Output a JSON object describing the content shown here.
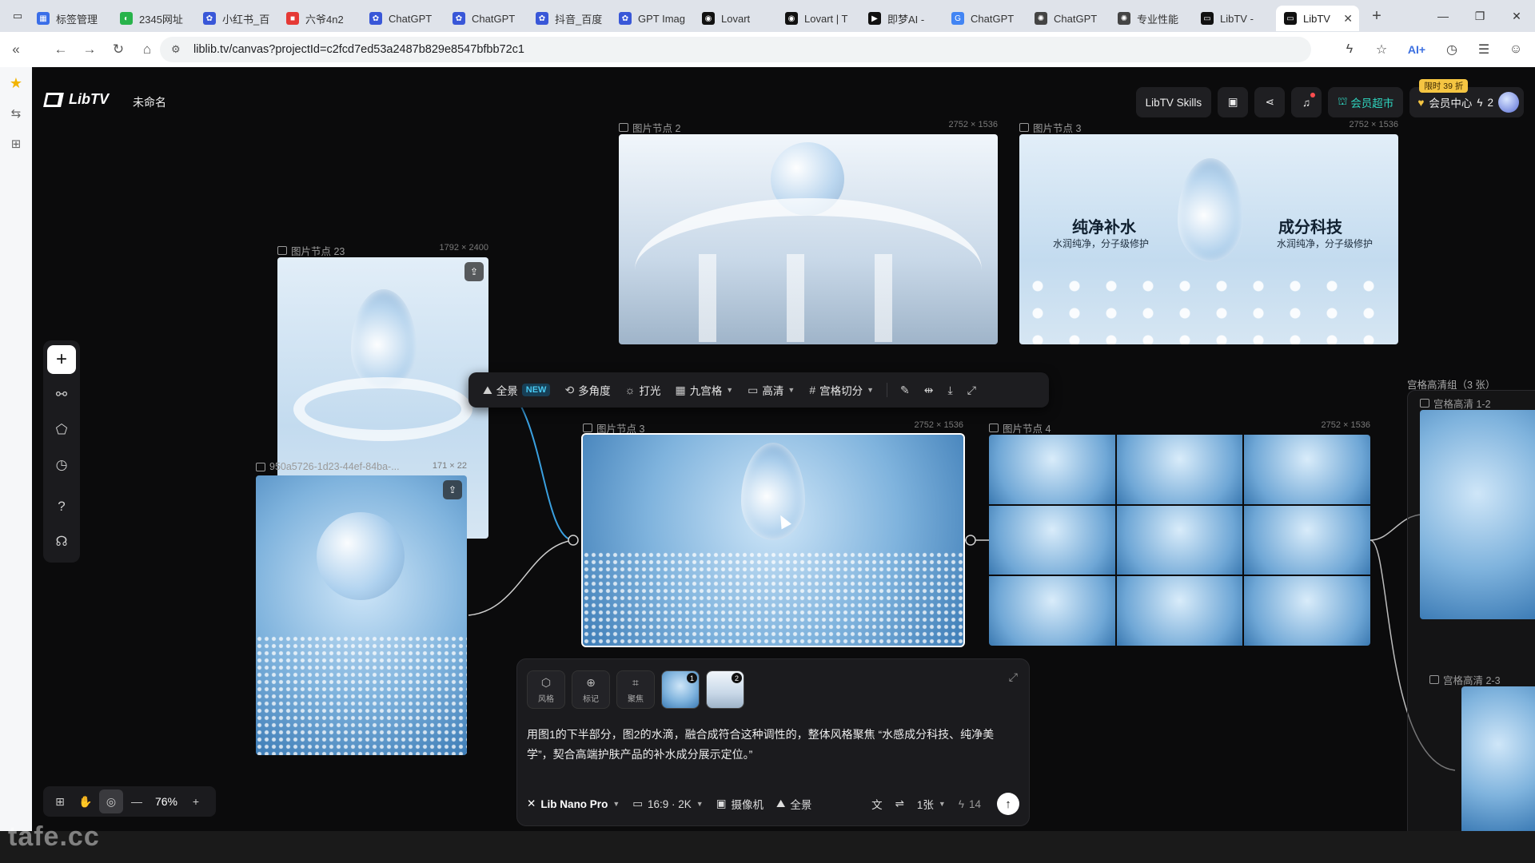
{
  "browser": {
    "tabs": [
      {
        "label": "标签管理",
        "fav_color": "#3a6ee8",
        "fav_icon": "grid-icon"
      },
      {
        "label": "2345网址",
        "fav_color": "#28b34b",
        "fav_icon": "globe-icon"
      },
      {
        "label": "小红书_百",
        "fav_color": "#3957d8",
        "fav_icon": "paw-icon"
      },
      {
        "label": "六爷4n2",
        "fav_color": "#e53935",
        "fav_icon": "app-icon"
      },
      {
        "label": "ChatGPT",
        "fav_color": "#3957d8",
        "fav_icon": "paw-icon"
      },
      {
        "label": "ChatGPT",
        "fav_color": "#3957d8",
        "fav_icon": "paw-icon"
      },
      {
        "label": "抖音_百度",
        "fav_color": "#3957d8",
        "fav_icon": "paw-icon"
      },
      {
        "label": "GPT Imag",
        "fav_color": "#3957d8",
        "fav_icon": "paw-icon"
      },
      {
        "label": "Lovart",
        "fav_color": "#111111",
        "fav_icon": "lovart-icon"
      },
      {
        "label": "Lovart | T",
        "fav_color": "#111111",
        "fav_icon": "lovart-icon"
      },
      {
        "label": "即梦AI -",
        "fav_color": "#111111",
        "fav_icon": "jimeng-icon"
      },
      {
        "label": "ChatGPT",
        "fav_color": "#4285f4",
        "fav_icon": "google-icon"
      },
      {
        "label": "ChatGPT",
        "fav_color": "#444444",
        "fav_icon": "openai-icon"
      },
      {
        "label": "专业性能",
        "fav_color": "#444444",
        "fav_icon": "openai-icon"
      },
      {
        "label": "LibTV -",
        "fav_color": "#111111",
        "fav_icon": "libtv-icon"
      },
      {
        "label": "LibTV",
        "fav_color": "#111111",
        "fav_icon": "libtv-icon",
        "active": true
      }
    ],
    "url": "liblib.tv/canvas?projectId=c2fcd7ed53a2487b829e8547bfbb72c1",
    "ai_label": "AI+"
  },
  "app": {
    "logo": "LibTV",
    "project_name": "未命名",
    "skills_label": "LibTV Skills",
    "vip_market_label": "会员超市",
    "member_center_label": "会员中心",
    "credits": "2",
    "promo_badge": "限时 39 折",
    "accent": "#2fd6c0"
  },
  "nodes": {
    "n2": {
      "label": "图片节点 2",
      "dims": "2752 × 1536"
    },
    "n3top": {
      "label": "图片节点 3",
      "dims": "2752 × 1536",
      "headline_left": "纯净补水",
      "sub_left": "水润纯净，分子级修护",
      "headline_right": "成分科技",
      "sub_right": "水润纯净，分子级修护"
    },
    "n23": {
      "label": "图片节点 23",
      "dims": "1792 × 2400"
    },
    "nfile": {
      "label": "950a5726-1d23-44ef-84ba-...",
      "dims": "171 × 22"
    },
    "n3": {
      "label": "图片节点 3",
      "dims": "2752 × 1536"
    },
    "n4": {
      "label": "图片节点 4",
      "dims": "2752 × 1536"
    },
    "group": {
      "label": "宫格高清组（3 张）",
      "item1": "宫格高清 1-2",
      "item2": "宫格高清 2-3"
    }
  },
  "toolbar": {
    "panorama": "全景",
    "new_badge": "NEW",
    "multi_angle": "多角度",
    "relight": "打光",
    "nine_grid": "九宫格",
    "hd": "高清",
    "grid_split": "宫格切分"
  },
  "prompt": {
    "tool_style": "风格",
    "tool_mark": "标记",
    "tool_focus": "聚焦",
    "thumb1": "1",
    "thumb2": "2",
    "text": "用图1的下半部分，图2的水滴，融合成符合这种调性的，整体风格聚焦 “水感成分科技、纯净美学”，契合高端护肤产品的补水成分展示定位。”",
    "model": "Lib Nano Pro",
    "ratio": "16:9 · 2K",
    "camera": "摄像机",
    "panorama": "全景",
    "count": "1张",
    "cost": "14"
  },
  "zoom": {
    "value": "76%"
  },
  "watermark": "tafe.cc"
}
